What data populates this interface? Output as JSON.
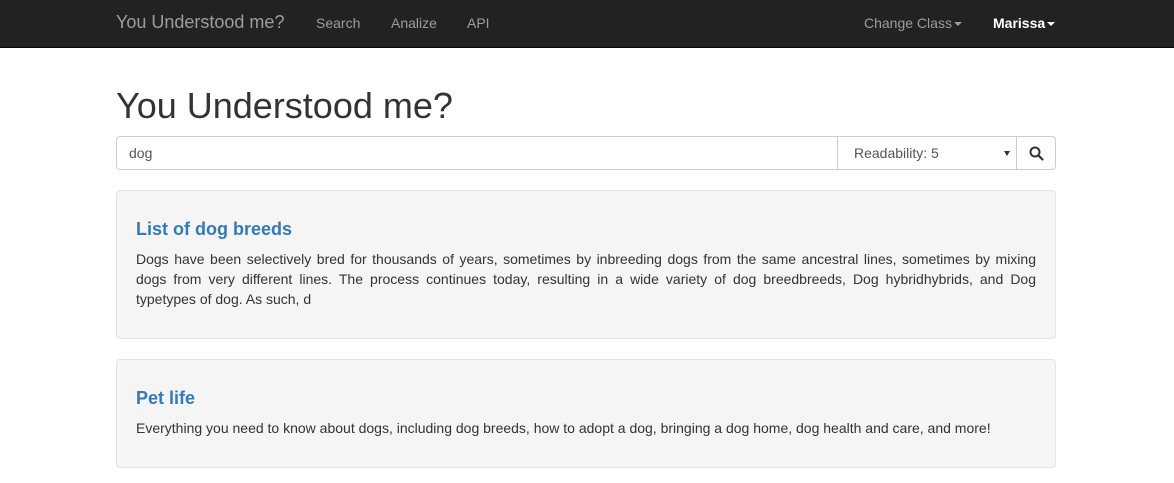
{
  "navbar": {
    "brand": "You Understood me?",
    "links": [
      "Search",
      "Analize",
      "API"
    ],
    "change_class": "Change Class",
    "user": "Marissa"
  },
  "page": {
    "title": "You Understood me?"
  },
  "search": {
    "query": "dog",
    "readability": "Readability: 5",
    "button_icon": "search-icon"
  },
  "results": [
    {
      "title": "List of dog breeds",
      "text": "Dogs have been selectively bred for thousands of years, sometimes by inbreeding dogs from the same ancestral lines, sometimes by mixing dogs from very different lines. The process continues today, resulting in a wide variety of dog breedbreeds, Dog hybridhybrids, and Dog typetypes of dog. As such, d"
    },
    {
      "title": "Pet life",
      "text": "Everything you need to know about dogs, including dog breeds, how to adopt a dog, bringing a dog home, dog health and care, and more!"
    }
  ],
  "colors": {
    "navbar_bg": "#222222",
    "nav_link": "#9d9d9d",
    "link_blue": "#337ab7",
    "card_bg": "#f5f5f5"
  }
}
